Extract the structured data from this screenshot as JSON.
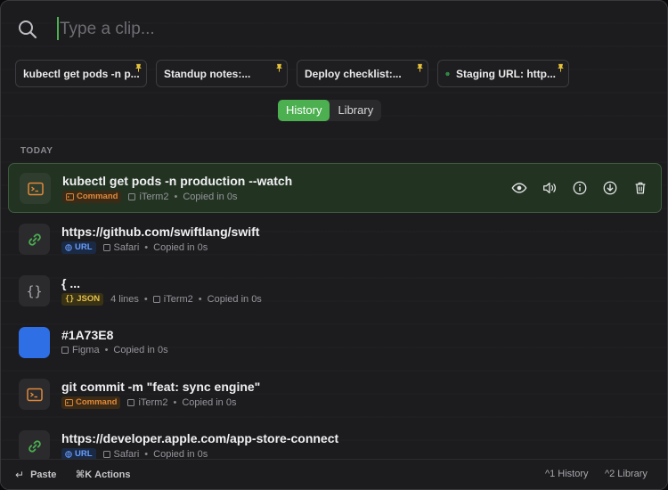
{
  "search": {
    "placeholder": "Type a clip..."
  },
  "pinned": [
    {
      "label": "kubectl get pods -n p..."
    },
    {
      "label": "Standup notes:..."
    },
    {
      "label": "Deploy checklist:..."
    },
    {
      "label": "Staging URL: http..."
    }
  ],
  "tabs": [
    {
      "label": "History",
      "active": true
    },
    {
      "label": "Library",
      "active": false
    }
  ],
  "section": {
    "label": "TODAY"
  },
  "rows": [
    {
      "title": "kubectl get pods -n production --watch",
      "badge": "Command",
      "app": "iTerm2",
      "copied": "Copied in 0s"
    },
    {
      "title": "https://github.com/swiftlang/swift",
      "badge": "URL",
      "app": "Safari",
      "copied": "Copied in 0s"
    },
    {
      "title": "{ ...",
      "badge": "JSON",
      "lines": "4 lines",
      "app": "iTerm2",
      "copied": "Copied in 0s"
    },
    {
      "title": "#1A73E8",
      "app": "Figma",
      "copied": "Copied in 0s",
      "swatch": "#2f6fe6"
    },
    {
      "title": "git commit -m \"feat: sync engine\"",
      "badge": "Command",
      "app": "iTerm2",
      "copied": "Copied in 0s"
    },
    {
      "title": "https://developer.apple.com/app-store-connect",
      "badge": "URL",
      "app": "Safari",
      "copied": "Copied in 0s"
    }
  ],
  "footer": {
    "paste_label": "Paste",
    "actions_key": "⌘K",
    "actions_label": "Actions",
    "history_key": "^1",
    "history_label": "History",
    "library_key": "^2",
    "library_label": "Library"
  },
  "colors": {
    "accent": "#4caf50",
    "command": "#e08a3a",
    "url": "#6a9dff",
    "json": "#e3c04a",
    "link_icon": "#4caf50"
  }
}
